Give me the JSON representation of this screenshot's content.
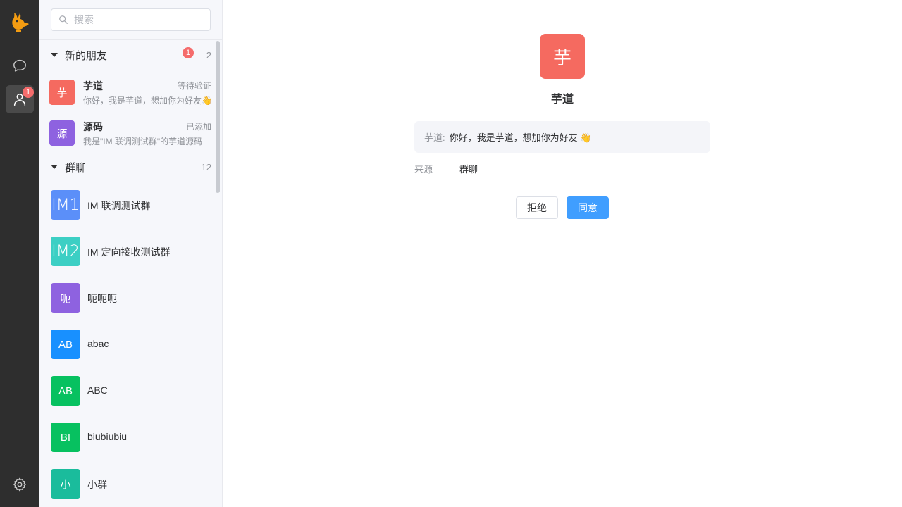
{
  "nav": {
    "contacts_badge": "1"
  },
  "search": {
    "placeholder": "搜索"
  },
  "sections": {
    "new_friends": {
      "title": "新的朋友",
      "badge": "1",
      "count": "2"
    },
    "groups": {
      "title": "群聊",
      "count": "12"
    }
  },
  "friends": [
    {
      "avatar_text": "芋",
      "avatar_color": "#f56a60",
      "name": "芋道",
      "status": "等待验证",
      "message": "你好，我是芋道，想加你为好友👋"
    },
    {
      "avatar_text": "源",
      "avatar_color": "#8e62e0",
      "name": "源码",
      "status": "已添加",
      "message": "我是\"IM 联调测试群\"的芋道源码"
    }
  ],
  "groups": [
    {
      "avatar_text": "IM1",
      "avatar_color": "#5b8ff9",
      "name": "IM 联调测试群"
    },
    {
      "avatar_text": "IM2",
      "avatar_color": "#3ccfc4",
      "name": "IM 定向接收测试群"
    },
    {
      "avatar_text": "呃",
      "avatar_color": "#8e62e0",
      "name": "呃呃呃"
    },
    {
      "avatar_text": "AB",
      "avatar_color": "#1890ff",
      "name": "abac"
    },
    {
      "avatar_text": "AB",
      "avatar_color": "#07c160",
      "name": "ABC"
    },
    {
      "avatar_text": "BI",
      "avatar_color": "#07c160",
      "name": "biubiubiu"
    },
    {
      "avatar_text": "小",
      "avatar_color": "#1abc9c",
      "name": "小群"
    }
  ],
  "detail": {
    "avatar_text": "芋",
    "name": "芋道",
    "request_from": "芋道:",
    "request_text": "你好，我是芋道，想加你为好友 👋",
    "source_label": "来源",
    "source_value": "群聊",
    "reject_label": "拒绝",
    "accept_label": "同意"
  },
  "colors": {
    "accent": "#409eff",
    "badge": "#f56c6c",
    "nav_bg": "#2e2e2e"
  }
}
